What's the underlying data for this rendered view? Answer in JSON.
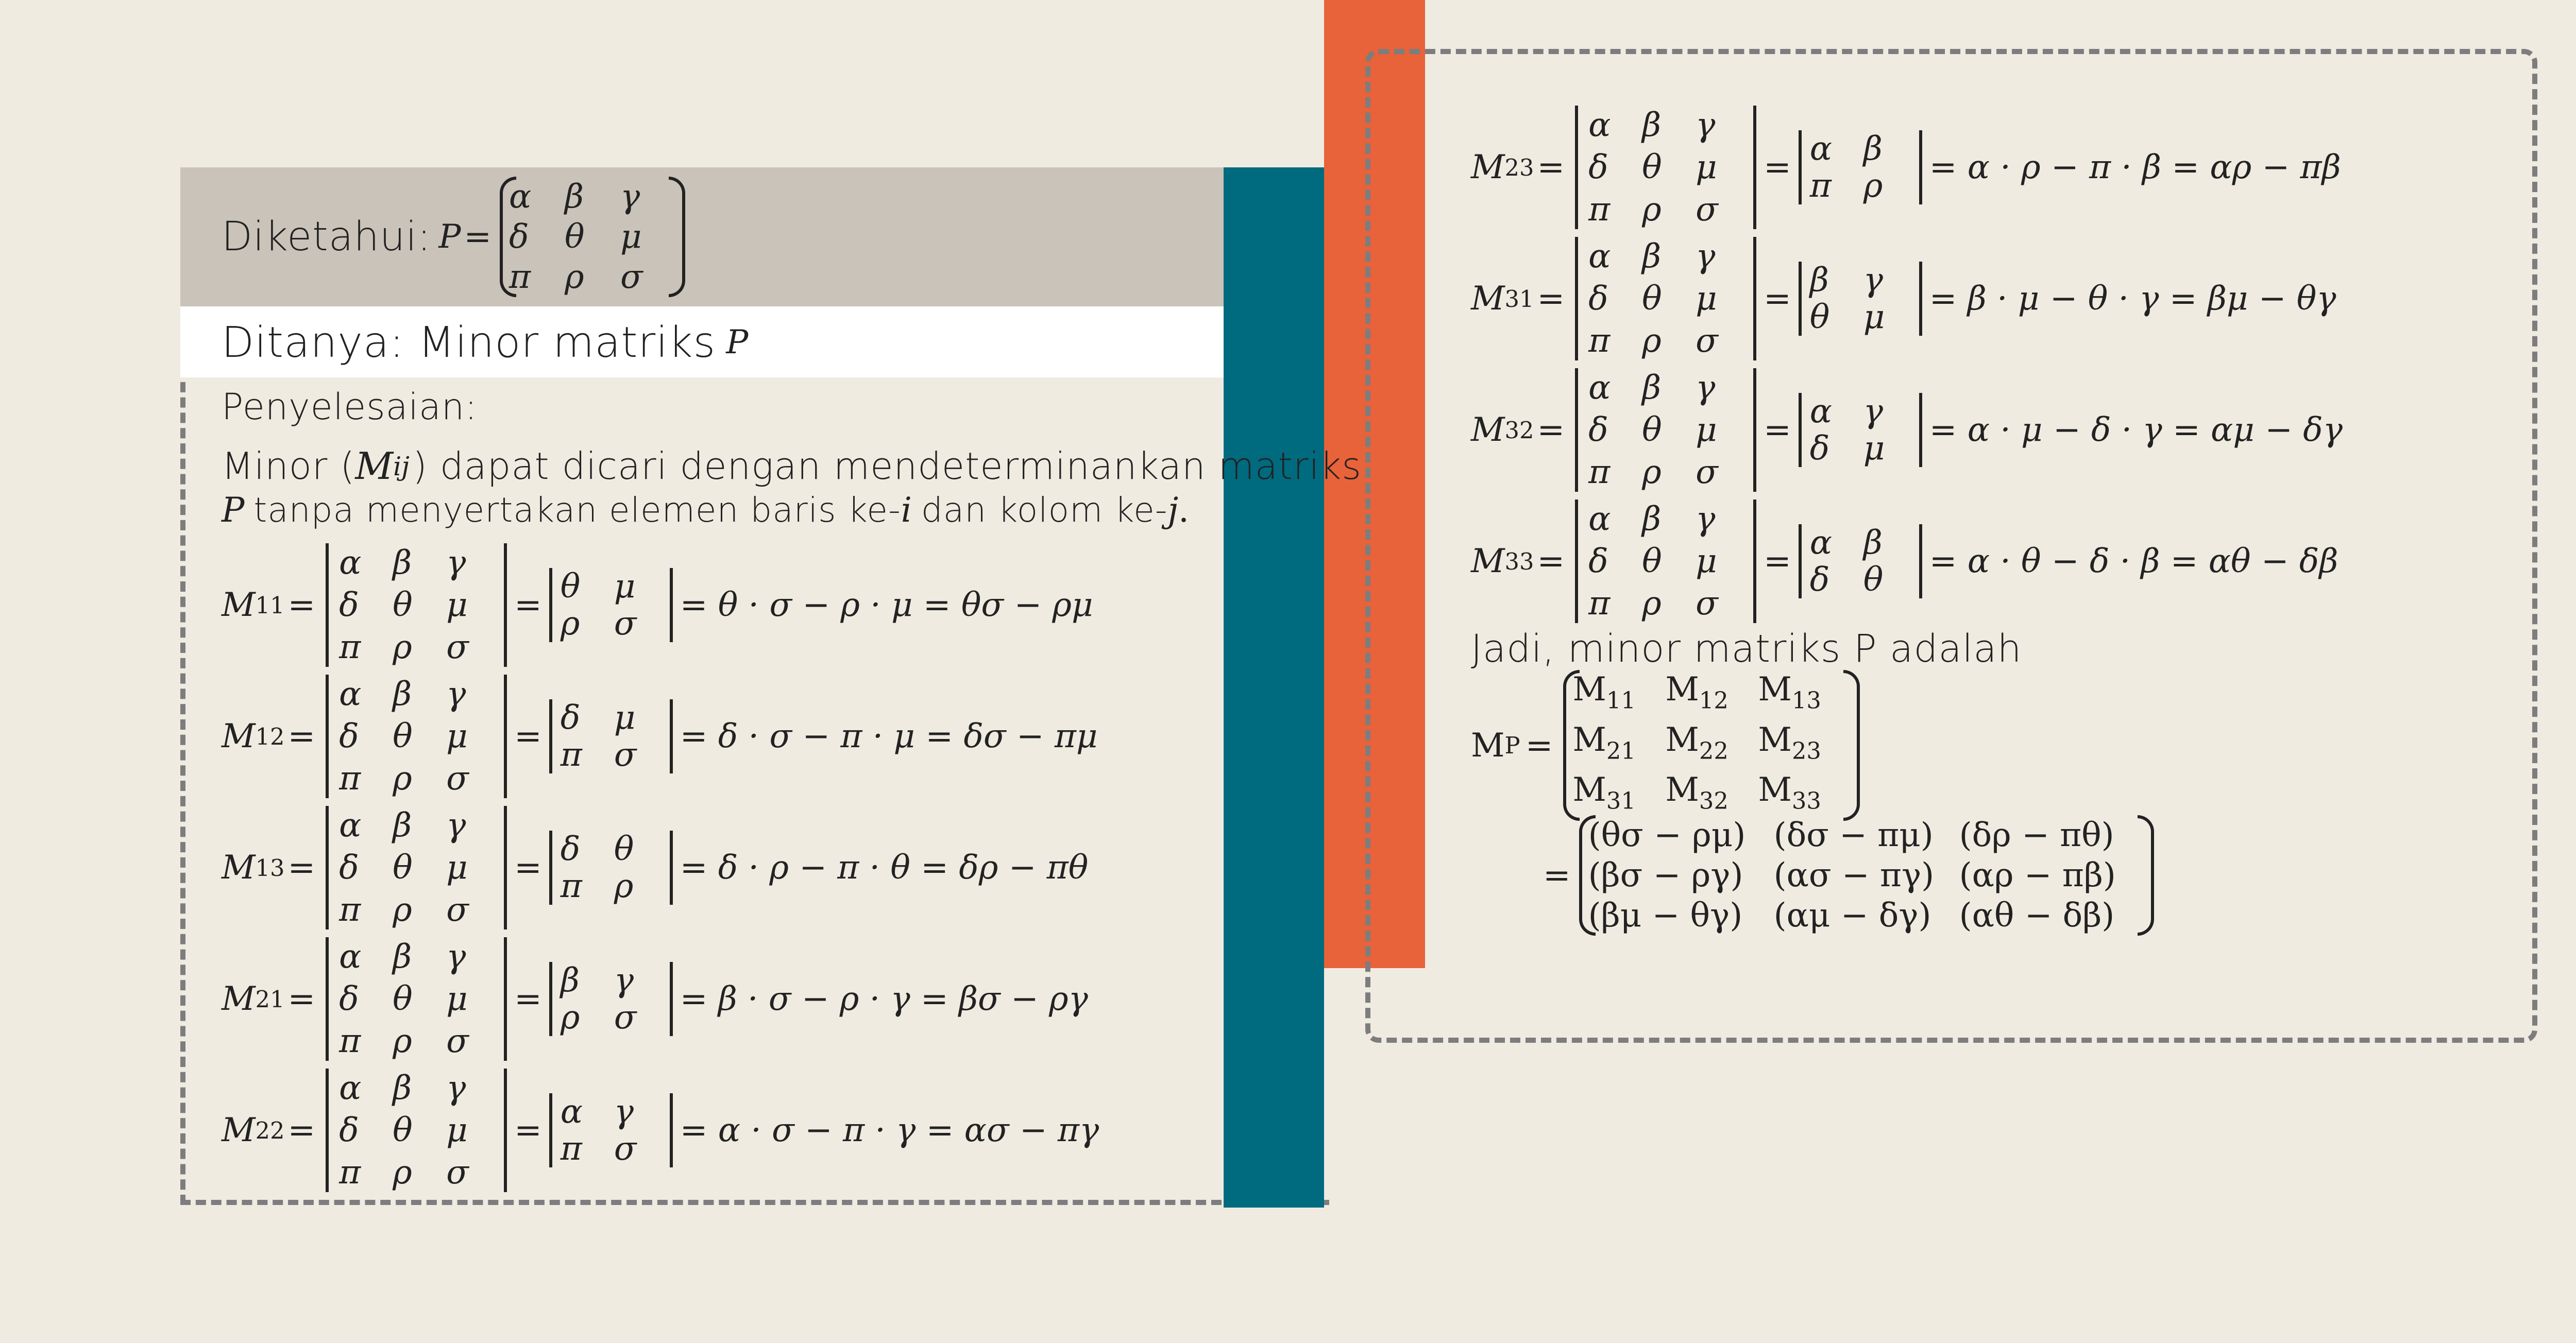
{
  "given": {
    "label": "Diketahui:",
    "matrix_name": "P",
    "matrix": [
      [
        "α",
        "β",
        "γ"
      ],
      [
        "δ",
        "θ",
        "μ"
      ],
      [
        "π",
        "ρ",
        "σ"
      ]
    ]
  },
  "asked": {
    "label": "Ditanya: Minor matriks",
    "var": "P"
  },
  "solution": {
    "heading": "Penyelesaian:",
    "line1_a": "Minor (",
    "line1_sym": "M",
    "line1_sub": "ij",
    "line1_b": ") dapat dicari dengan mendeterminankan matriks",
    "line2_p": "P",
    "line2_a": "tanpa  menyertakan elemen baris ke-",
    "line2_i": "i",
    "line2_b": "dan kolom ke-",
    "line2_j": "j",
    "line2_end": "."
  },
  "minors": [
    {
      "sub": "11",
      "minor": [
        [
          "θ",
          "μ"
        ],
        [
          "ρ",
          "σ"
        ]
      ],
      "expansion": "= θ · σ − ρ · μ = θσ − ρμ"
    },
    {
      "sub": "12",
      "minor": [
        [
          "δ",
          "μ"
        ],
        [
          "π",
          "σ"
        ]
      ],
      "expansion": "= δ · σ − π · μ = δσ − πμ"
    },
    {
      "sub": "13",
      "minor": [
        [
          "δ",
          "θ"
        ],
        [
          "π",
          "ρ"
        ]
      ],
      "expansion": "= δ · ρ − π · θ = δρ − πθ"
    },
    {
      "sub": "21",
      "minor": [
        [
          "β",
          "γ"
        ],
        [
          "ρ",
          "σ"
        ]
      ],
      "expansion": "= β · σ − ρ · γ = βσ − ργ"
    },
    {
      "sub": "22",
      "minor": [
        [
          "α",
          "γ"
        ],
        [
          "π",
          "σ"
        ]
      ],
      "expansion": "= α · σ − π · γ = ασ − πγ"
    },
    {
      "sub": "23",
      "minor": [
        [
          "α",
          "β"
        ],
        [
          "π",
          "ρ"
        ]
      ],
      "expansion": "= α · ρ − π · β = αρ − πβ"
    },
    {
      "sub": "31",
      "minor": [
        [
          "β",
          "γ"
        ],
        [
          "θ",
          "μ"
        ]
      ],
      "expansion": "= β · μ − θ · γ = βμ − θγ"
    },
    {
      "sub": "32",
      "minor": [
        [
          "α",
          "γ"
        ],
        [
          "δ",
          "μ"
        ]
      ],
      "expansion": "= α · μ − δ · γ = αμ − δγ"
    },
    {
      "sub": "33",
      "minor": [
        [
          "α",
          "β"
        ],
        [
          "δ",
          "θ"
        ]
      ],
      "expansion": "= α · θ − δ · β = αθ − δβ"
    }
  ],
  "conclusion": {
    "text": "Jadi, minor matriks P adalah",
    "lhs": "M",
    "lhs_sub": "P",
    "symbolic": [
      [
        "M11",
        "M12",
        "M13"
      ],
      [
        "M21",
        "M22",
        "M23"
      ],
      [
        "M31",
        "M32",
        "M33"
      ]
    ],
    "result": [
      [
        "(θσ − ρμ)",
        "(δσ − πμ)",
        "(δρ − πθ)"
      ],
      [
        "(βσ − ργ)",
        "(ασ − πγ)",
        "(αρ − πβ)"
      ],
      [
        "(βμ − θγ)",
        "(αμ − δγ)",
        "(αθ − δβ)"
      ]
    ]
  },
  "colors": {
    "background": "#f0ebe1",
    "teal": "#006a7f",
    "orange": "#e8623a",
    "gray_bar": "#c9c3b9"
  }
}
